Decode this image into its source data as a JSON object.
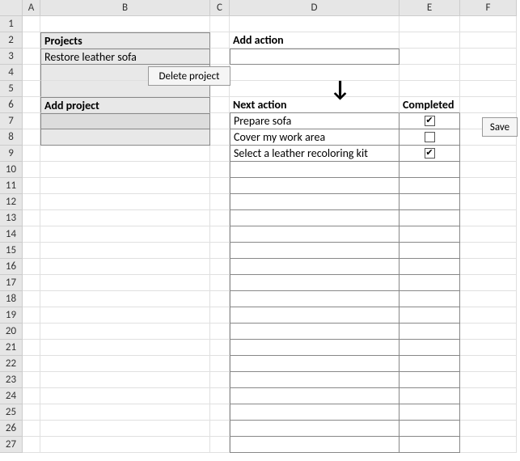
{
  "columns": [
    "A",
    "B",
    "C",
    "D",
    "E",
    "F"
  ],
  "rows_count": 27,
  "projects": {
    "header": "Projects",
    "items": [
      "Restore leather sofa"
    ]
  },
  "add_project_label": "Add project",
  "add_action_label": "Add action",
  "next_action_header": "Next action",
  "completed_header": "Completed",
  "actions": [
    {
      "text": "Prepare sofa",
      "completed": true
    },
    {
      "text": "Cover my work area",
      "completed": false
    },
    {
      "text": "Select a leather recoloring kit",
      "completed": true
    }
  ],
  "buttons": {
    "delete_project": "Delete project",
    "save": "Save"
  },
  "checkbox_mark": "✔"
}
